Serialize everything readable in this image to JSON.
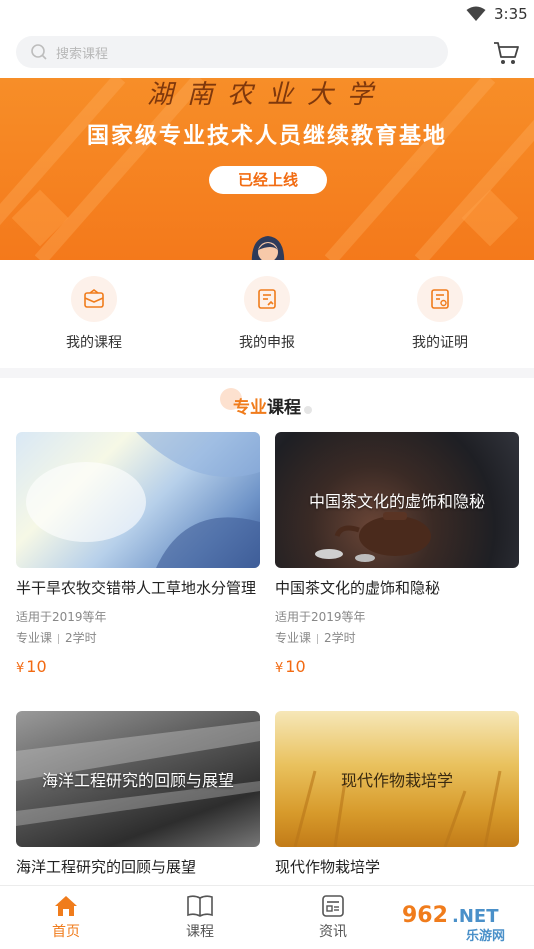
{
  "status_bar": {
    "time": "3:35"
  },
  "search": {
    "placeholder": "搜索课程"
  },
  "banner": {
    "calligraphy": "湖南农业大学",
    "headline": "国家级专业技术人员继续教育基地",
    "badge": "已经上线"
  },
  "quick_actions": [
    {
      "label": "我的课程",
      "icon": "course-icon"
    },
    {
      "label": "我的申报",
      "icon": "apply-icon"
    },
    {
      "label": "我的证明",
      "icon": "certificate-icon"
    }
  ],
  "section": {
    "title_highlight": "专业",
    "title_rest": "课程"
  },
  "courses": [
    {
      "title": "半干旱农牧交错带人工草地水分管理",
      "overlay": "",
      "applicable": "适用于2019等年",
      "type": "专业课",
      "hours": "2学时",
      "currency": "¥",
      "price": "10"
    },
    {
      "title": "中国茶文化的虚饰和隐秘",
      "overlay": "中国茶文化的虚饰和隐秘",
      "applicable": "适用于2019等年",
      "type": "专业课",
      "hours": "2学时",
      "currency": "¥",
      "price": "10"
    },
    {
      "title": "海洋工程研究的回顾与展望",
      "overlay": "海洋工程研究的回顾与展望",
      "applicable": "",
      "type": "",
      "hours": "",
      "currency": "",
      "price": ""
    },
    {
      "title": "现代作物栽培学",
      "overlay": "现代作物栽培学",
      "applicable": "",
      "type": "",
      "hours": "",
      "currency": "",
      "price": ""
    }
  ],
  "tabs": [
    {
      "label": "首页",
      "icon": "home-icon",
      "active": true
    },
    {
      "label": "课程",
      "icon": "book-icon",
      "active": false
    },
    {
      "label": "资讯",
      "icon": "news-icon",
      "active": false
    }
  ],
  "watermark": {
    "text": "962.NET",
    "subtext": "乐游网"
  },
  "colors": {
    "accent": "#f07c1c",
    "banner": "#f78e28",
    "price": "#f26a12"
  }
}
